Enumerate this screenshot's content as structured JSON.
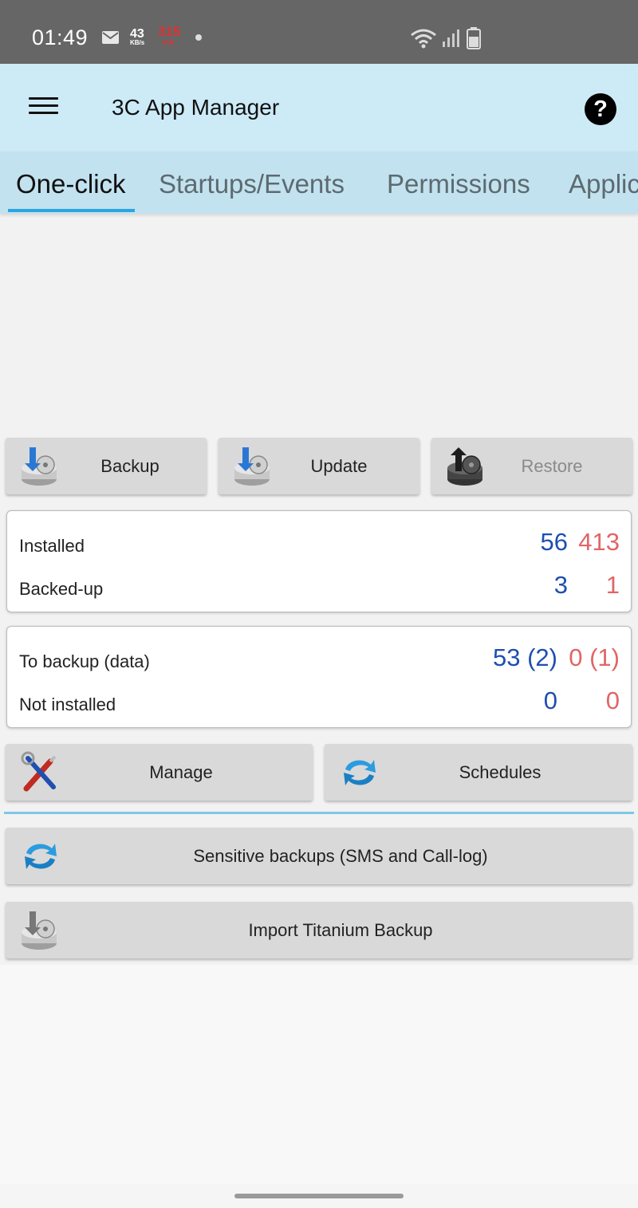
{
  "status_bar": {
    "time": "01:49",
    "data_rate": "43",
    "data_unit": "KB/s",
    "current_value": "315",
    "current_unit": "mA"
  },
  "app_bar": {
    "title": "3C App Manager",
    "help_label": "?"
  },
  "tabs": [
    {
      "label": "One-click",
      "active": true
    },
    {
      "label": "Startups/Events",
      "active": false
    },
    {
      "label": "Permissions",
      "active": false
    },
    {
      "label": "Applic",
      "active": false
    }
  ],
  "actions": {
    "backup": "Backup",
    "update": "Update",
    "restore": "Restore",
    "manage": "Manage",
    "schedules": "Schedules",
    "sensitive_backups": "Sensitive backups (SMS and Call-log)",
    "import_titanium": "Import Titanium Backup"
  },
  "stats_card": {
    "installed_label": "Installed",
    "installed_user": "56",
    "installed_system": "413",
    "backed_up_label": "Backed-up",
    "backed_up_user": "3",
    "backed_up_system": "1"
  },
  "backup_card": {
    "to_backup_label": "To backup (data)",
    "to_backup_user": "53 (2)",
    "to_backup_system": "0 (1)",
    "not_installed_label": "Not installed",
    "not_installed_user": "0",
    "not_installed_system": "0"
  },
  "colors": {
    "user_count": "#1f4fb0",
    "system_count": "#e06666",
    "accent": "#2aa5e0",
    "app_bar": "#cdeaf7"
  }
}
